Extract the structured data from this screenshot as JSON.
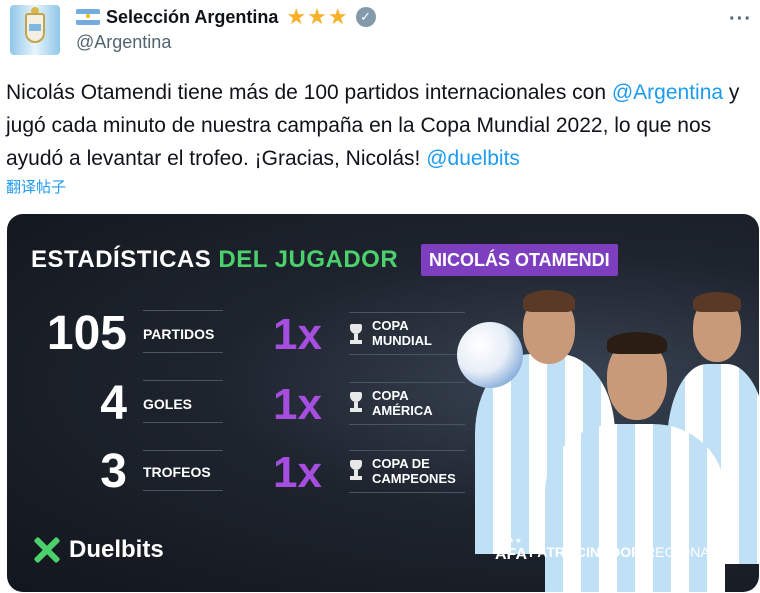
{
  "account": {
    "display_name": "Selección Argentina",
    "handle": "@Argentina",
    "flag_icon": "argentina-flag-icon",
    "stars": 3,
    "star_color": "#f7b128",
    "verified_icon": "verified-check-icon",
    "verified_color": "#829aab",
    "more_label": "···"
  },
  "tweet": {
    "text_part1": "Nicolás Otamendi tiene más de 100 partidos internacionales con",
    "mention_argentina": "@Argentina",
    "text_part2": " y jugó cada minuto de nuestra campaña en la Copa Mundial 2022, lo que nos ayudó a levantar el trofeo. ¡Gracias, Nicolás! ",
    "mention_duelbits": "@duelbits",
    "translate_label": "翻译帖子",
    "link_color": "#1d9bf0"
  },
  "card": {
    "title_white": "ESTADÍSTICAS ",
    "title_green": "DEL JUGADOR",
    "player_name": "NICOLÁS OTAMENDI",
    "accent_green": "#4bd06b",
    "accent_purple": "#7d3fbf",
    "stats": [
      {
        "value": "105",
        "label": "PARTIDOS"
      },
      {
        "value": "4",
        "label": "GOLES"
      },
      {
        "value": "3",
        "label": "TROFEOS"
      }
    ],
    "trophies": [
      {
        "count": "1x",
        "line1": "COPA",
        "line2": "MUNDIAL"
      },
      {
        "count": "1x",
        "line1": "COPA",
        "line2": "AMÉRICA"
      },
      {
        "count": "1x",
        "line1": "COPA DE",
        "line2": "CAMPEONES"
      }
    ],
    "brand": "Duelbits",
    "afa_text": "AFA",
    "sponsor_bold": "PATROCINADOR",
    "sponsor_rest": " REGIONAL"
  }
}
